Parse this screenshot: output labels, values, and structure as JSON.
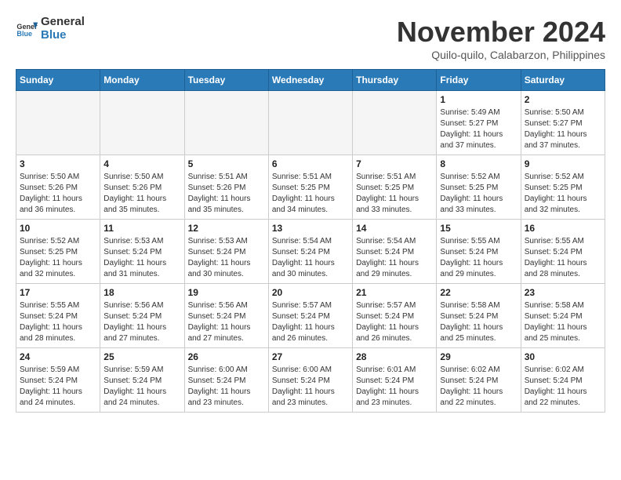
{
  "header": {
    "logo_line1": "General",
    "logo_line2": "Blue",
    "month_title": "November 2024",
    "subtitle": "Quilo-quilo, Calabarzon, Philippines"
  },
  "days_of_week": [
    "Sunday",
    "Monday",
    "Tuesday",
    "Wednesday",
    "Thursday",
    "Friday",
    "Saturday"
  ],
  "weeks": [
    [
      {
        "day": "",
        "empty": true
      },
      {
        "day": "",
        "empty": true
      },
      {
        "day": "",
        "empty": true
      },
      {
        "day": "",
        "empty": true
      },
      {
        "day": "",
        "empty": true
      },
      {
        "day": "1",
        "sunrise": "5:49 AM",
        "sunset": "5:27 PM",
        "daylight": "11 hours and 37 minutes."
      },
      {
        "day": "2",
        "sunrise": "5:50 AM",
        "sunset": "5:27 PM",
        "daylight": "11 hours and 37 minutes."
      }
    ],
    [
      {
        "day": "3",
        "sunrise": "5:50 AM",
        "sunset": "5:26 PM",
        "daylight": "11 hours and 36 minutes."
      },
      {
        "day": "4",
        "sunrise": "5:50 AM",
        "sunset": "5:26 PM",
        "daylight": "11 hours and 35 minutes."
      },
      {
        "day": "5",
        "sunrise": "5:51 AM",
        "sunset": "5:26 PM",
        "daylight": "11 hours and 35 minutes."
      },
      {
        "day": "6",
        "sunrise": "5:51 AM",
        "sunset": "5:25 PM",
        "daylight": "11 hours and 34 minutes."
      },
      {
        "day": "7",
        "sunrise": "5:51 AM",
        "sunset": "5:25 PM",
        "daylight": "11 hours and 33 minutes."
      },
      {
        "day": "8",
        "sunrise": "5:52 AM",
        "sunset": "5:25 PM",
        "daylight": "11 hours and 33 minutes."
      },
      {
        "day": "9",
        "sunrise": "5:52 AM",
        "sunset": "5:25 PM",
        "daylight": "11 hours and 32 minutes."
      }
    ],
    [
      {
        "day": "10",
        "sunrise": "5:52 AM",
        "sunset": "5:25 PM",
        "daylight": "11 hours and 32 minutes."
      },
      {
        "day": "11",
        "sunrise": "5:53 AM",
        "sunset": "5:24 PM",
        "daylight": "11 hours and 31 minutes."
      },
      {
        "day": "12",
        "sunrise": "5:53 AM",
        "sunset": "5:24 PM",
        "daylight": "11 hours and 30 minutes."
      },
      {
        "day": "13",
        "sunrise": "5:54 AM",
        "sunset": "5:24 PM",
        "daylight": "11 hours and 30 minutes."
      },
      {
        "day": "14",
        "sunrise": "5:54 AM",
        "sunset": "5:24 PM",
        "daylight": "11 hours and 29 minutes."
      },
      {
        "day": "15",
        "sunrise": "5:55 AM",
        "sunset": "5:24 PM",
        "daylight": "11 hours and 29 minutes."
      },
      {
        "day": "16",
        "sunrise": "5:55 AM",
        "sunset": "5:24 PM",
        "daylight": "11 hours and 28 minutes."
      }
    ],
    [
      {
        "day": "17",
        "sunrise": "5:55 AM",
        "sunset": "5:24 PM",
        "daylight": "11 hours and 28 minutes."
      },
      {
        "day": "18",
        "sunrise": "5:56 AM",
        "sunset": "5:24 PM",
        "daylight": "11 hours and 27 minutes."
      },
      {
        "day": "19",
        "sunrise": "5:56 AM",
        "sunset": "5:24 PM",
        "daylight": "11 hours and 27 minutes."
      },
      {
        "day": "20",
        "sunrise": "5:57 AM",
        "sunset": "5:24 PM",
        "daylight": "11 hours and 26 minutes."
      },
      {
        "day": "21",
        "sunrise": "5:57 AM",
        "sunset": "5:24 PM",
        "daylight": "11 hours and 26 minutes."
      },
      {
        "day": "22",
        "sunrise": "5:58 AM",
        "sunset": "5:24 PM",
        "daylight": "11 hours and 25 minutes."
      },
      {
        "day": "23",
        "sunrise": "5:58 AM",
        "sunset": "5:24 PM",
        "daylight": "11 hours and 25 minutes."
      }
    ],
    [
      {
        "day": "24",
        "sunrise": "5:59 AM",
        "sunset": "5:24 PM",
        "daylight": "11 hours and 24 minutes."
      },
      {
        "day": "25",
        "sunrise": "5:59 AM",
        "sunset": "5:24 PM",
        "daylight": "11 hours and 24 minutes."
      },
      {
        "day": "26",
        "sunrise": "6:00 AM",
        "sunset": "5:24 PM",
        "daylight": "11 hours and 23 minutes."
      },
      {
        "day": "27",
        "sunrise": "6:00 AM",
        "sunset": "5:24 PM",
        "daylight": "11 hours and 23 minutes."
      },
      {
        "day": "28",
        "sunrise": "6:01 AM",
        "sunset": "5:24 PM",
        "daylight": "11 hours and 23 minutes."
      },
      {
        "day": "29",
        "sunrise": "6:02 AM",
        "sunset": "5:24 PM",
        "daylight": "11 hours and 22 minutes."
      },
      {
        "day": "30",
        "sunrise": "6:02 AM",
        "sunset": "5:24 PM",
        "daylight": "11 hours and 22 minutes."
      }
    ]
  ],
  "labels": {
    "sunrise": "Sunrise:",
    "sunset": "Sunset:",
    "daylight": "Daylight:"
  }
}
